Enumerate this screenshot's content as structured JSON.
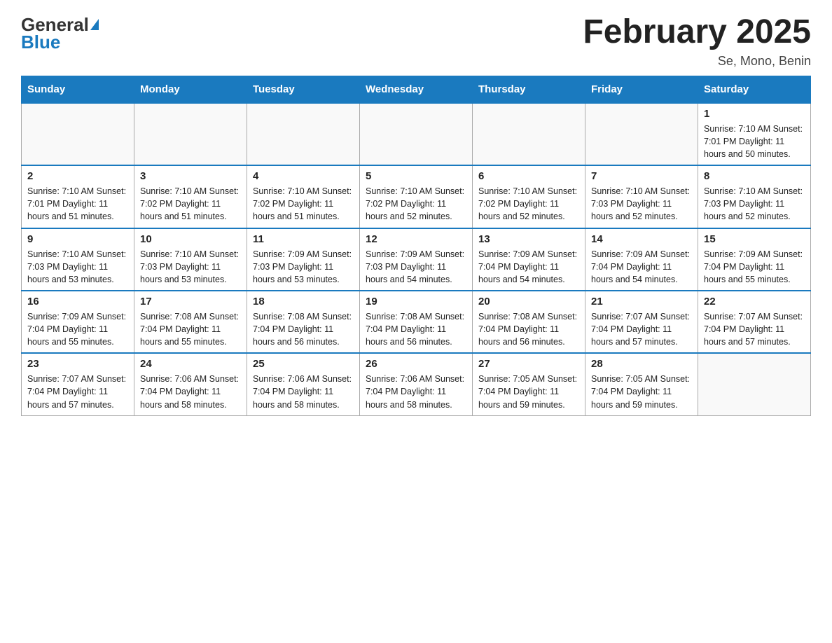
{
  "header": {
    "logo_general": "General",
    "logo_blue": "Blue",
    "month_title": "February 2025",
    "location": "Se, Mono, Benin"
  },
  "weekdays": [
    "Sunday",
    "Monday",
    "Tuesday",
    "Wednesday",
    "Thursday",
    "Friday",
    "Saturday"
  ],
  "weeks": [
    [
      {
        "day": "",
        "info": ""
      },
      {
        "day": "",
        "info": ""
      },
      {
        "day": "",
        "info": ""
      },
      {
        "day": "",
        "info": ""
      },
      {
        "day": "",
        "info": ""
      },
      {
        "day": "",
        "info": ""
      },
      {
        "day": "1",
        "info": "Sunrise: 7:10 AM\nSunset: 7:01 PM\nDaylight: 11 hours\nand 50 minutes."
      }
    ],
    [
      {
        "day": "2",
        "info": "Sunrise: 7:10 AM\nSunset: 7:01 PM\nDaylight: 11 hours\nand 51 minutes."
      },
      {
        "day": "3",
        "info": "Sunrise: 7:10 AM\nSunset: 7:02 PM\nDaylight: 11 hours\nand 51 minutes."
      },
      {
        "day": "4",
        "info": "Sunrise: 7:10 AM\nSunset: 7:02 PM\nDaylight: 11 hours\nand 51 minutes."
      },
      {
        "day": "5",
        "info": "Sunrise: 7:10 AM\nSunset: 7:02 PM\nDaylight: 11 hours\nand 52 minutes."
      },
      {
        "day": "6",
        "info": "Sunrise: 7:10 AM\nSunset: 7:02 PM\nDaylight: 11 hours\nand 52 minutes."
      },
      {
        "day": "7",
        "info": "Sunrise: 7:10 AM\nSunset: 7:03 PM\nDaylight: 11 hours\nand 52 minutes."
      },
      {
        "day": "8",
        "info": "Sunrise: 7:10 AM\nSunset: 7:03 PM\nDaylight: 11 hours\nand 52 minutes."
      }
    ],
    [
      {
        "day": "9",
        "info": "Sunrise: 7:10 AM\nSunset: 7:03 PM\nDaylight: 11 hours\nand 53 minutes."
      },
      {
        "day": "10",
        "info": "Sunrise: 7:10 AM\nSunset: 7:03 PM\nDaylight: 11 hours\nand 53 minutes."
      },
      {
        "day": "11",
        "info": "Sunrise: 7:09 AM\nSunset: 7:03 PM\nDaylight: 11 hours\nand 53 minutes."
      },
      {
        "day": "12",
        "info": "Sunrise: 7:09 AM\nSunset: 7:03 PM\nDaylight: 11 hours\nand 54 minutes."
      },
      {
        "day": "13",
        "info": "Sunrise: 7:09 AM\nSunset: 7:04 PM\nDaylight: 11 hours\nand 54 minutes."
      },
      {
        "day": "14",
        "info": "Sunrise: 7:09 AM\nSunset: 7:04 PM\nDaylight: 11 hours\nand 54 minutes."
      },
      {
        "day": "15",
        "info": "Sunrise: 7:09 AM\nSunset: 7:04 PM\nDaylight: 11 hours\nand 55 minutes."
      }
    ],
    [
      {
        "day": "16",
        "info": "Sunrise: 7:09 AM\nSunset: 7:04 PM\nDaylight: 11 hours\nand 55 minutes."
      },
      {
        "day": "17",
        "info": "Sunrise: 7:08 AM\nSunset: 7:04 PM\nDaylight: 11 hours\nand 55 minutes."
      },
      {
        "day": "18",
        "info": "Sunrise: 7:08 AM\nSunset: 7:04 PM\nDaylight: 11 hours\nand 56 minutes."
      },
      {
        "day": "19",
        "info": "Sunrise: 7:08 AM\nSunset: 7:04 PM\nDaylight: 11 hours\nand 56 minutes."
      },
      {
        "day": "20",
        "info": "Sunrise: 7:08 AM\nSunset: 7:04 PM\nDaylight: 11 hours\nand 56 minutes."
      },
      {
        "day": "21",
        "info": "Sunrise: 7:07 AM\nSunset: 7:04 PM\nDaylight: 11 hours\nand 57 minutes."
      },
      {
        "day": "22",
        "info": "Sunrise: 7:07 AM\nSunset: 7:04 PM\nDaylight: 11 hours\nand 57 minutes."
      }
    ],
    [
      {
        "day": "23",
        "info": "Sunrise: 7:07 AM\nSunset: 7:04 PM\nDaylight: 11 hours\nand 57 minutes."
      },
      {
        "day": "24",
        "info": "Sunrise: 7:06 AM\nSunset: 7:04 PM\nDaylight: 11 hours\nand 58 minutes."
      },
      {
        "day": "25",
        "info": "Sunrise: 7:06 AM\nSunset: 7:04 PM\nDaylight: 11 hours\nand 58 minutes."
      },
      {
        "day": "26",
        "info": "Sunrise: 7:06 AM\nSunset: 7:04 PM\nDaylight: 11 hours\nand 58 minutes."
      },
      {
        "day": "27",
        "info": "Sunrise: 7:05 AM\nSunset: 7:04 PM\nDaylight: 11 hours\nand 59 minutes."
      },
      {
        "day": "28",
        "info": "Sunrise: 7:05 AM\nSunset: 7:04 PM\nDaylight: 11 hours\nand 59 minutes."
      },
      {
        "day": "",
        "info": ""
      }
    ]
  ]
}
